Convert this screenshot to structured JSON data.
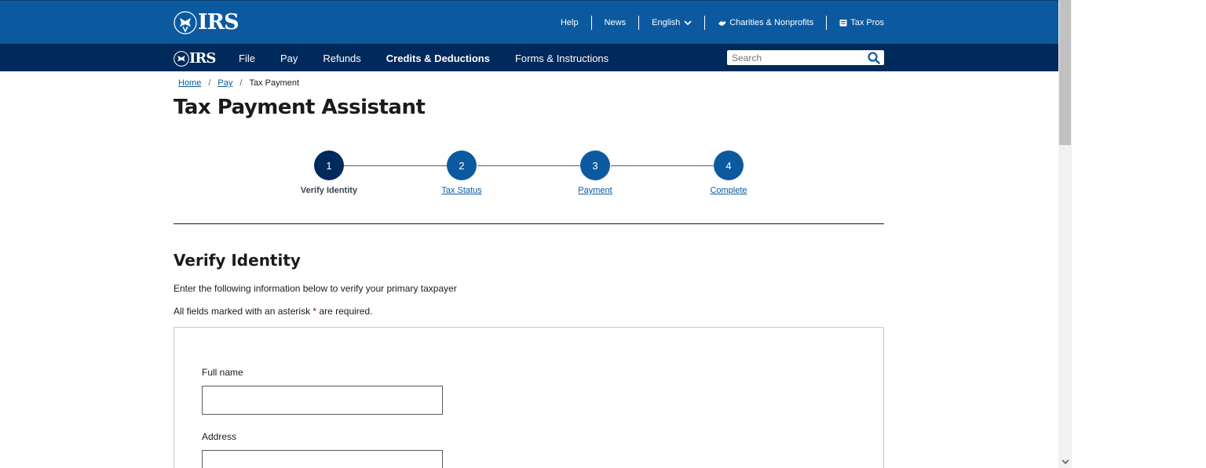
{
  "header": {
    "logo_text": "IRS",
    "utility_nav": [
      {
        "label": "Help"
      },
      {
        "label": "News"
      },
      {
        "label": "English"
      },
      {
        "label": "Charities & Nonprofits"
      },
      {
        "label": "Tax Pros"
      }
    ]
  },
  "main_nav": {
    "logo_text": "IRS",
    "items": [
      {
        "label": "File"
      },
      {
        "label": "Pay"
      },
      {
        "label": "Refunds"
      },
      {
        "label": "Credits & Deductions"
      },
      {
        "label": "Forms & Instructions"
      }
    ],
    "search": {
      "placeholder": "Search"
    }
  },
  "breadcrumb": {
    "items": [
      "Home",
      "Pay"
    ],
    "current": "Tax Payment"
  },
  "page_title": "Tax Payment Assistant",
  "stepper": {
    "steps": [
      {
        "number": "1",
        "label": "Verify Identity"
      },
      {
        "number": "2",
        "label": "Tax Status"
      },
      {
        "number": "3",
        "label": "Payment"
      },
      {
        "number": "4",
        "label": "Complete"
      }
    ]
  },
  "section": {
    "title": "Verify Identity",
    "intro": "Enter the following information below to verify your primary taxpayer",
    "required_prefix": "All fields marked with an asterisk",
    "asterisk": "*",
    "required_suffix": "are required."
  },
  "form": {
    "fields": [
      {
        "label": "Full name",
        "value": ""
      },
      {
        "label": "Address",
        "value": ""
      }
    ]
  },
  "colors": {
    "header_blue": "#0b5aa0",
    "nav_navy": "#00295c",
    "active_step": "#00295c",
    "required_red": "#b50909"
  }
}
